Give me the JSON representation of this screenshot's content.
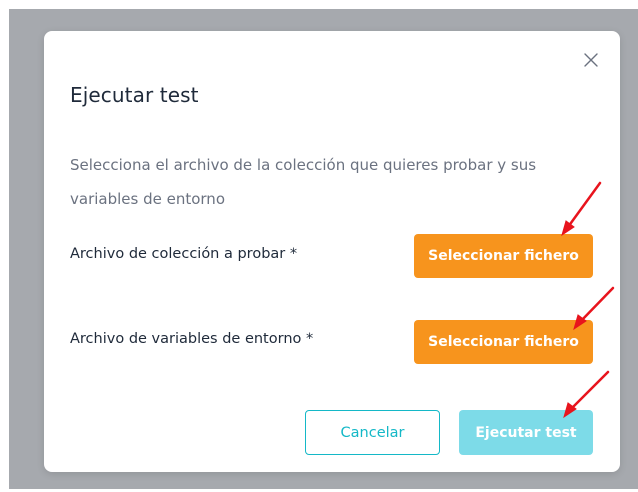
{
  "modal": {
    "title": "Ejecutar test",
    "description": "Selecciona el archivo de la colección que quieres probar y sus variables de entorno",
    "close_icon": "close-icon",
    "fields": [
      {
        "label": "Archivo de colección a probar *",
        "button_label": "Seleccionar fichero"
      },
      {
        "label": "Archivo de variables de entorno *",
        "button_label": "Seleccionar fichero"
      }
    ],
    "footer": {
      "cancel_label": "Cancelar",
      "run_label": "Ejecutar test"
    }
  },
  "colors": {
    "accent_orange": "#f7941d",
    "accent_teal": "#14b8c7",
    "run_disabled": "#7ddbe8",
    "backdrop": "#a6a9ae",
    "annotation_arrow": "#e8141d"
  }
}
